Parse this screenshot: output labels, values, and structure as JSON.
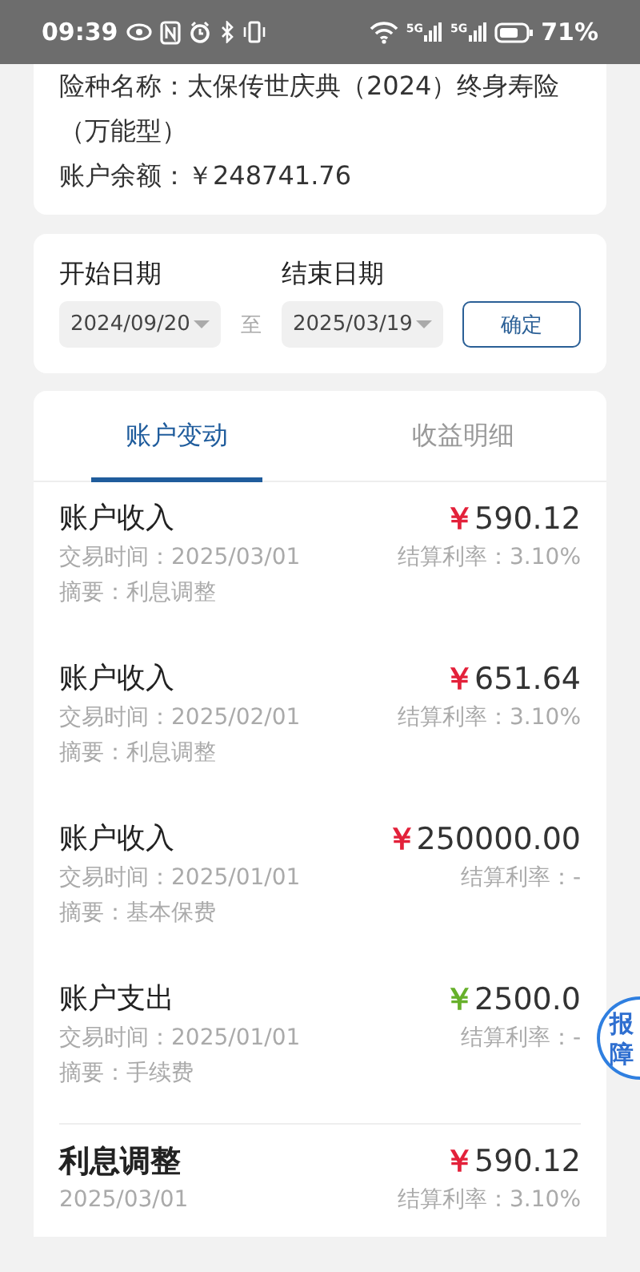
{
  "status_bar": {
    "time": "09:39",
    "network_labels": [
      "5G",
      "5G"
    ],
    "battery": "71%"
  },
  "policy": {
    "name_line": "险种名称：太保传世庆典（2024）终身寿险（万能型）",
    "balance": "账户余额：￥248741.76"
  },
  "date_filter": {
    "start_label": "开始日期",
    "start_value": "2024/09/20",
    "separator": "至",
    "end_label": "结束日期",
    "end_value": "2025/03/19",
    "confirm": "确定"
  },
  "tabs": [
    {
      "label": "账户变动",
      "selected": true
    },
    {
      "label": "收益明细",
      "selected": false
    }
  ],
  "transactions": [
    {
      "kind": "income",
      "title": "账户收入",
      "currency": "￥",
      "amount": "590.12",
      "time": "交易时间：2025/03/01",
      "summary": "摘要：利息调整",
      "rate": "结算利率：3.10%"
    },
    {
      "kind": "income",
      "title": "账户收入",
      "currency": "￥",
      "amount": "651.64",
      "time": "交易时间：2025/02/01",
      "summary": "摘要：利息调整",
      "rate": "结算利率：3.10%"
    },
    {
      "kind": "income",
      "title": "账户收入",
      "currency": "￥",
      "amount": "250000.00",
      "time": "交易时间：2025/01/01",
      "summary": "摘要：基本保费",
      "rate": "结算利率：-"
    },
    {
      "kind": "expense",
      "title": "账户支出",
      "currency": "￥",
      "amount": "2500.0",
      "time": "交易时间：2025/01/01",
      "summary": "摘要：手续费",
      "rate": "结算利率：-"
    }
  ],
  "adjustments": [
    {
      "title": "利息调整",
      "date": "2025/03/01",
      "currency": "￥",
      "amount": "590.12",
      "rate": "结算利率：3.10%"
    }
  ],
  "report_badge": "报障"
}
